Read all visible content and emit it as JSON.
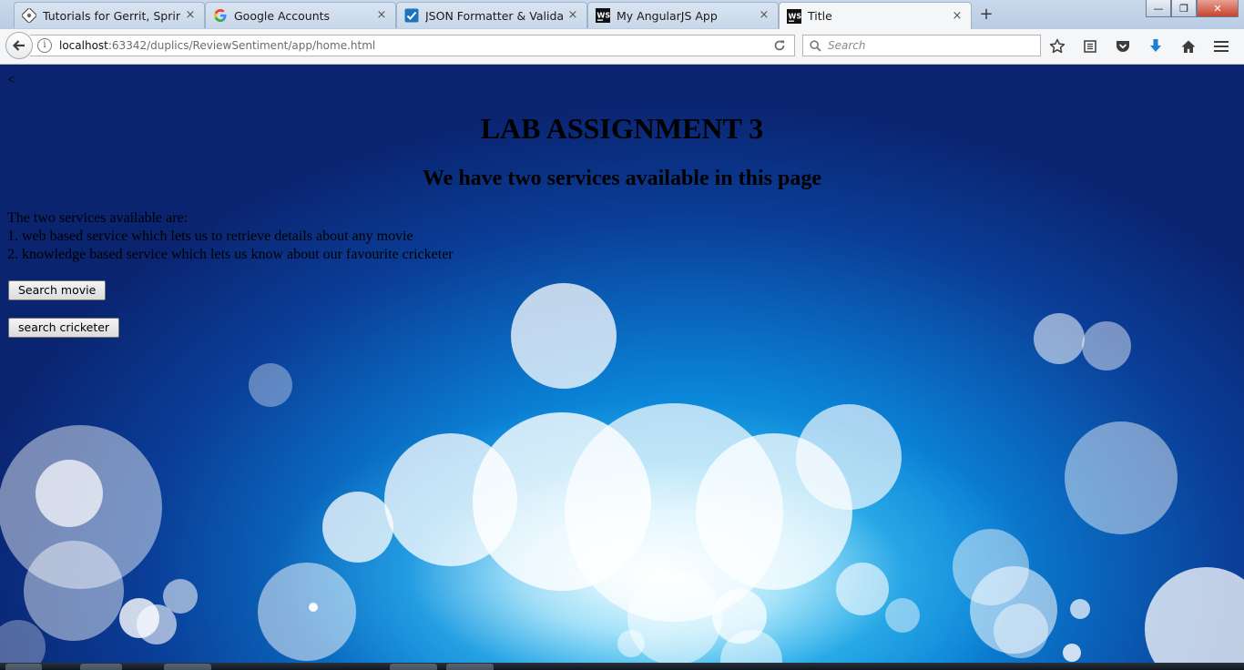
{
  "browser": {
    "tabs": [
      {
        "label": "Tutorials for Gerrit, Spring ...",
        "icon": "gerrit-favicon-icon",
        "active": false
      },
      {
        "label": "Google Accounts",
        "icon": "google-favicon-icon",
        "active": false
      },
      {
        "label": "JSON Formatter & Validator",
        "icon": "checkmark-favicon-icon",
        "active": false
      },
      {
        "label": "My AngularJS App",
        "icon": "webstorm-favicon-icon",
        "active": false
      },
      {
        "label": "Title",
        "icon": "webstorm-favicon-icon",
        "active": true
      }
    ],
    "close_glyph": "×",
    "new_tab_glyph": "+",
    "window_controls": {
      "minimize": "—",
      "maximize": "❐",
      "close": "✕"
    },
    "url": {
      "host": "localhost",
      "rest": ":63342/duplics/ReviewSentiment/app/home.html"
    },
    "search": {
      "placeholder": "Search",
      "value": ""
    },
    "toolbar_icons": [
      "bookmark-star-icon",
      "reading-list-icon",
      "pocket-icon",
      "download-icon",
      "home-icon",
      "menu-icon"
    ]
  },
  "page": {
    "back_link": "<",
    "title": "LAB ASSIGNMENT 3",
    "subtitle": "We have two services available in this page",
    "services_intro": "The two services available are:",
    "service_1": "1. web based service which lets us to retrieve details about any movie",
    "service_2": "2. knowledge based service which lets us know about our favourite cricketer",
    "search_movie_label": "Search movie",
    "search_cricketer_label": "search cricketer"
  },
  "colors": {
    "background_deep": "#0a2470",
    "background_mid": "#0a82d6",
    "background_glow": "#20c0f0",
    "accent_download": "#1a7fd6"
  }
}
